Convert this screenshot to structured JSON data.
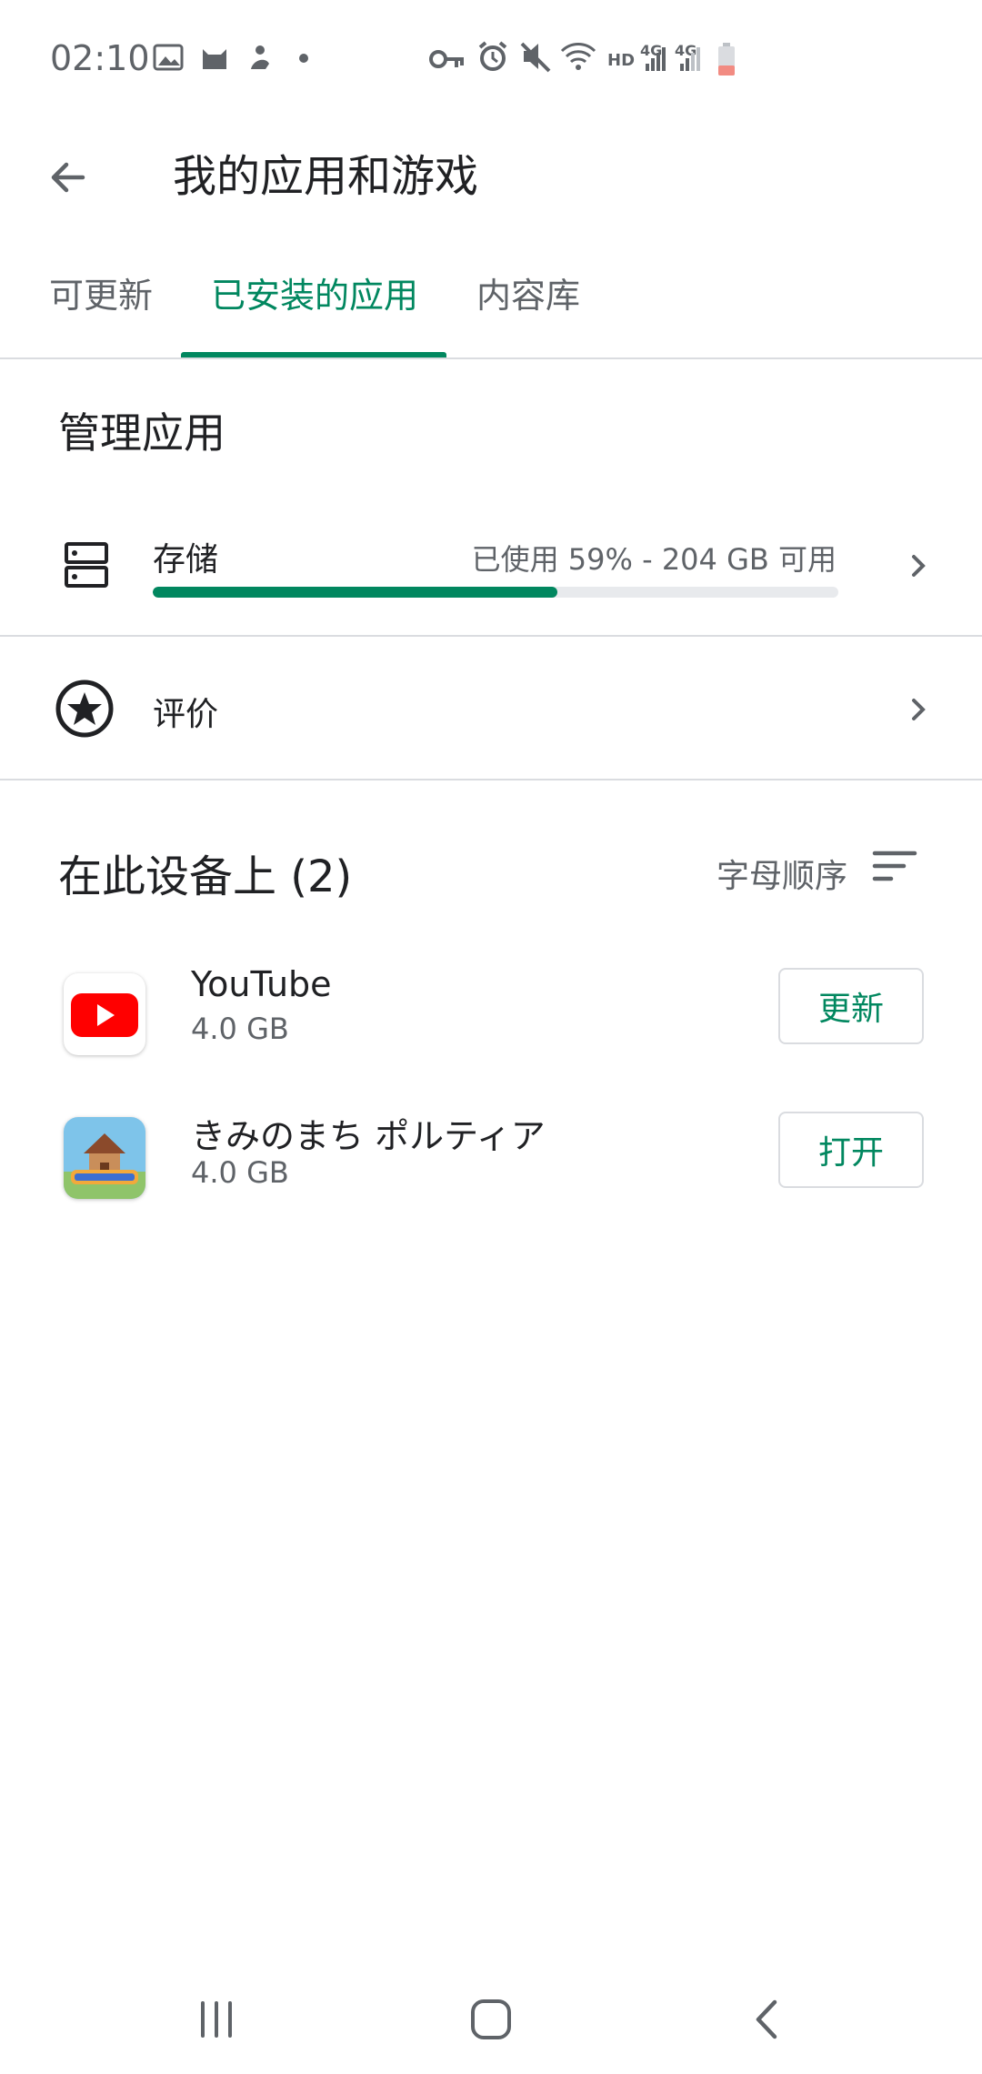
{
  "status_bar": {
    "time": "02:10",
    "left_icons": [
      "image-icon",
      "cat-icon",
      "figure-icon",
      "dot-icon"
    ],
    "right_icons": [
      "key-icon",
      "alarm-icon",
      "mute-icon",
      "wifi-icon",
      "hd-icon",
      "signal-4g-icon",
      "signal-4g-icon",
      "battery-icon"
    ],
    "hd_label": "HD",
    "net1": "4G",
    "net2": "4G"
  },
  "app_bar": {
    "title": "我的应用和游戏"
  },
  "tabs": [
    {
      "label": "可更新",
      "active": false
    },
    {
      "label": "已安装的应用",
      "active": true
    },
    {
      "label": "内容库",
      "active": false
    }
  ],
  "manage": {
    "title": "管理应用",
    "storage": {
      "label": "存储",
      "info": "已使用 59% - 204 GB 可用",
      "used_fraction": 0.59
    },
    "rating": {
      "label": "评价"
    }
  },
  "device": {
    "title": "在此设备上 (2)",
    "sort_label": "字母顺序",
    "apps": [
      {
        "name": "YouTube",
        "size": "4.0 GB",
        "action": "更新"
      },
      {
        "name": "きみのまち ポルティア",
        "size": "4.0 GB",
        "action": "打开"
      }
    ]
  },
  "colors": {
    "accent": "#01875f",
    "youtube_red": "#ff0000",
    "divider": "#dadce0"
  }
}
